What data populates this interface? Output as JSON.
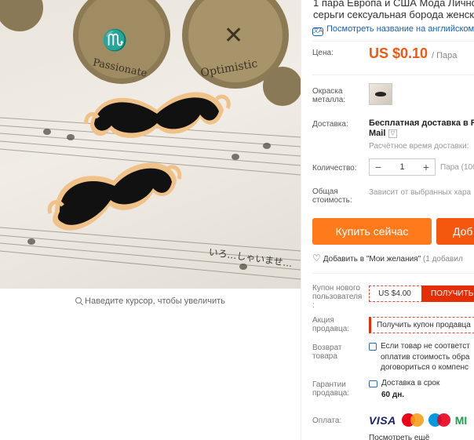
{
  "product": {
    "title_lines": [
      "1 пара Европа и США Мода Личное",
      "серьги сексуальная борода женски"
    ],
    "translate_link": "Посмотреть название на английском",
    "zoom_hint": "Наведите курсор, чтобы увеличить",
    "photo_coins": [
      "Passionate",
      "Optimistic"
    ],
    "photo_note_text": "いろ…しゃいませ…"
  },
  "price": {
    "label": "Цена:",
    "value": "US $0.10",
    "unit": "/ Пара"
  },
  "color": {
    "label_lines": [
      "Окраска",
      "металла:"
    ]
  },
  "shipping": {
    "label": "Доставка:",
    "method": "Бесплатная доставка в Rus",
    "method_cont": "Mail",
    "dropdown_glyph": "▽",
    "estimate": "Расчётное время доставки:"
  },
  "quantity": {
    "label": "Количество:",
    "minus": "−",
    "value": "1",
    "plus": "+",
    "unit": "Пара (100"
  },
  "total": {
    "label_lines": [
      "Общая",
      "стоимость:"
    ],
    "note": "Зависит от выбранных хара"
  },
  "buttons": {
    "buy": "Купить сейчас",
    "cart": "Доб"
  },
  "wishlist": {
    "label": "Добавить в \"Мои желания\"",
    "count": "(1 добавил"
  },
  "new_user_coupon": {
    "label_lines": [
      "Купон нового",
      "пользователя",
      ":"
    ],
    "amount": "US $4.00",
    "action": "ПОЛУЧИТЬ"
  },
  "store_promo": {
    "label_lines": [
      "Акция",
      "продавца:"
    ],
    "action": "Получить купон продавца"
  },
  "returns": {
    "label_lines": [
      "Возврат",
      "товара"
    ],
    "text_lines": [
      "Если товар не соответст",
      "оплатив стоимость обра",
      "договориться о компенс"
    ]
  },
  "guarantee": {
    "label_lines": [
      "Гарантии",
      "продавца:"
    ],
    "text": "Доставка в срок",
    "days": "60 дн."
  },
  "payment": {
    "label": "Оплата:",
    "visa": "VISA",
    "last": "MI",
    "more": "Посмотреть ещё"
  },
  "colors": {
    "accent": "#f5570f",
    "buy": "#ff7a1a",
    "link": "#1a5fb4",
    "coupon_red": "#e62e04"
  }
}
